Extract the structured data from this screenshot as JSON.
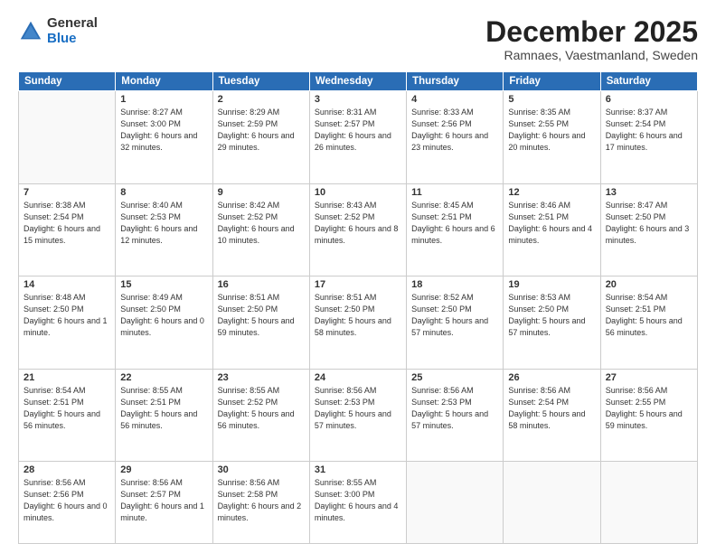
{
  "logo": {
    "general": "General",
    "blue": "Blue"
  },
  "header": {
    "month": "December 2025",
    "location": "Ramnaes, Vaestmanland, Sweden"
  },
  "weekdays": [
    "Sunday",
    "Monday",
    "Tuesday",
    "Wednesday",
    "Thursday",
    "Friday",
    "Saturday"
  ],
  "weeks": [
    [
      {
        "day": "",
        "empty": true
      },
      {
        "day": "1",
        "sunrise": "Sunrise: 8:27 AM",
        "sunset": "Sunset: 3:00 PM",
        "daylight": "Daylight: 6 hours and 32 minutes."
      },
      {
        "day": "2",
        "sunrise": "Sunrise: 8:29 AM",
        "sunset": "Sunset: 2:59 PM",
        "daylight": "Daylight: 6 hours and 29 minutes."
      },
      {
        "day": "3",
        "sunrise": "Sunrise: 8:31 AM",
        "sunset": "Sunset: 2:57 PM",
        "daylight": "Daylight: 6 hours and 26 minutes."
      },
      {
        "day": "4",
        "sunrise": "Sunrise: 8:33 AM",
        "sunset": "Sunset: 2:56 PM",
        "daylight": "Daylight: 6 hours and 23 minutes."
      },
      {
        "day": "5",
        "sunrise": "Sunrise: 8:35 AM",
        "sunset": "Sunset: 2:55 PM",
        "daylight": "Daylight: 6 hours and 20 minutes."
      },
      {
        "day": "6",
        "sunrise": "Sunrise: 8:37 AM",
        "sunset": "Sunset: 2:54 PM",
        "daylight": "Daylight: 6 hours and 17 minutes."
      }
    ],
    [
      {
        "day": "7",
        "sunrise": "Sunrise: 8:38 AM",
        "sunset": "Sunset: 2:54 PM",
        "daylight": "Daylight: 6 hours and 15 minutes."
      },
      {
        "day": "8",
        "sunrise": "Sunrise: 8:40 AM",
        "sunset": "Sunset: 2:53 PM",
        "daylight": "Daylight: 6 hours and 12 minutes."
      },
      {
        "day": "9",
        "sunrise": "Sunrise: 8:42 AM",
        "sunset": "Sunset: 2:52 PM",
        "daylight": "Daylight: 6 hours and 10 minutes."
      },
      {
        "day": "10",
        "sunrise": "Sunrise: 8:43 AM",
        "sunset": "Sunset: 2:52 PM",
        "daylight": "Daylight: 6 hours and 8 minutes."
      },
      {
        "day": "11",
        "sunrise": "Sunrise: 8:45 AM",
        "sunset": "Sunset: 2:51 PM",
        "daylight": "Daylight: 6 hours and 6 minutes."
      },
      {
        "day": "12",
        "sunrise": "Sunrise: 8:46 AM",
        "sunset": "Sunset: 2:51 PM",
        "daylight": "Daylight: 6 hours and 4 minutes."
      },
      {
        "day": "13",
        "sunrise": "Sunrise: 8:47 AM",
        "sunset": "Sunset: 2:50 PM",
        "daylight": "Daylight: 6 hours and 3 minutes."
      }
    ],
    [
      {
        "day": "14",
        "sunrise": "Sunrise: 8:48 AM",
        "sunset": "Sunset: 2:50 PM",
        "daylight": "Daylight: 6 hours and 1 minute."
      },
      {
        "day": "15",
        "sunrise": "Sunrise: 8:49 AM",
        "sunset": "Sunset: 2:50 PM",
        "daylight": "Daylight: 6 hours and 0 minutes."
      },
      {
        "day": "16",
        "sunrise": "Sunrise: 8:51 AM",
        "sunset": "Sunset: 2:50 PM",
        "daylight": "Daylight: 5 hours and 59 minutes."
      },
      {
        "day": "17",
        "sunrise": "Sunrise: 8:51 AM",
        "sunset": "Sunset: 2:50 PM",
        "daylight": "Daylight: 5 hours and 58 minutes."
      },
      {
        "day": "18",
        "sunrise": "Sunrise: 8:52 AM",
        "sunset": "Sunset: 2:50 PM",
        "daylight": "Daylight: 5 hours and 57 minutes."
      },
      {
        "day": "19",
        "sunrise": "Sunrise: 8:53 AM",
        "sunset": "Sunset: 2:50 PM",
        "daylight": "Daylight: 5 hours and 57 minutes."
      },
      {
        "day": "20",
        "sunrise": "Sunrise: 8:54 AM",
        "sunset": "Sunset: 2:51 PM",
        "daylight": "Daylight: 5 hours and 56 minutes."
      }
    ],
    [
      {
        "day": "21",
        "sunrise": "Sunrise: 8:54 AM",
        "sunset": "Sunset: 2:51 PM",
        "daylight": "Daylight: 5 hours and 56 minutes."
      },
      {
        "day": "22",
        "sunrise": "Sunrise: 8:55 AM",
        "sunset": "Sunset: 2:51 PM",
        "daylight": "Daylight: 5 hours and 56 minutes."
      },
      {
        "day": "23",
        "sunrise": "Sunrise: 8:55 AM",
        "sunset": "Sunset: 2:52 PM",
        "daylight": "Daylight: 5 hours and 56 minutes."
      },
      {
        "day": "24",
        "sunrise": "Sunrise: 8:56 AM",
        "sunset": "Sunset: 2:53 PM",
        "daylight": "Daylight: 5 hours and 57 minutes."
      },
      {
        "day": "25",
        "sunrise": "Sunrise: 8:56 AM",
        "sunset": "Sunset: 2:53 PM",
        "daylight": "Daylight: 5 hours and 57 minutes."
      },
      {
        "day": "26",
        "sunrise": "Sunrise: 8:56 AM",
        "sunset": "Sunset: 2:54 PM",
        "daylight": "Daylight: 5 hours and 58 minutes."
      },
      {
        "day": "27",
        "sunrise": "Sunrise: 8:56 AM",
        "sunset": "Sunset: 2:55 PM",
        "daylight": "Daylight: 5 hours and 59 minutes."
      }
    ],
    [
      {
        "day": "28",
        "sunrise": "Sunrise: 8:56 AM",
        "sunset": "Sunset: 2:56 PM",
        "daylight": "Daylight: 6 hours and 0 minutes."
      },
      {
        "day": "29",
        "sunrise": "Sunrise: 8:56 AM",
        "sunset": "Sunset: 2:57 PM",
        "daylight": "Daylight: 6 hours and 1 minute."
      },
      {
        "day": "30",
        "sunrise": "Sunrise: 8:56 AM",
        "sunset": "Sunset: 2:58 PM",
        "daylight": "Daylight: 6 hours and 2 minutes."
      },
      {
        "day": "31",
        "sunrise": "Sunrise: 8:55 AM",
        "sunset": "Sunset: 3:00 PM",
        "daylight": "Daylight: 6 hours and 4 minutes."
      },
      {
        "day": "",
        "empty": true
      },
      {
        "day": "",
        "empty": true
      },
      {
        "day": "",
        "empty": true
      }
    ]
  ]
}
